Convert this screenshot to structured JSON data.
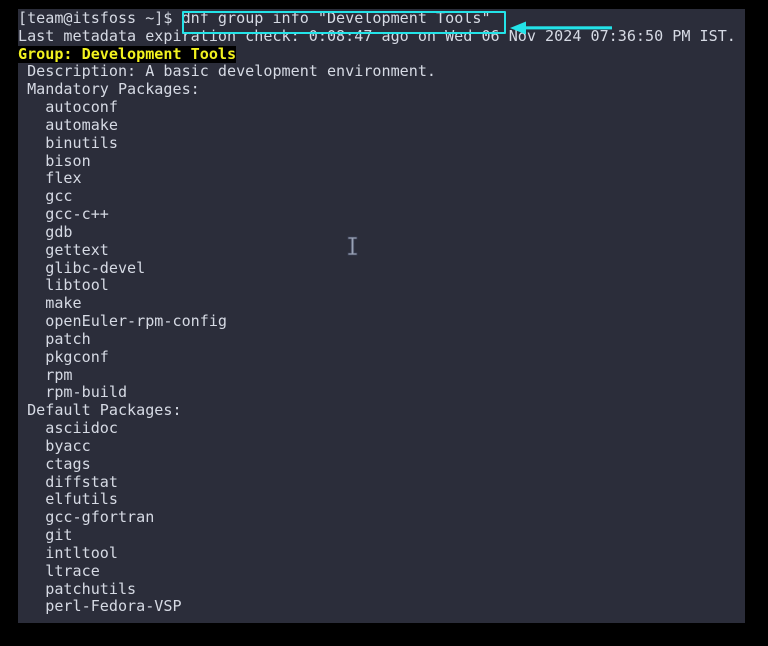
{
  "terminal": {
    "background_color": "#2b2d3a",
    "text_color": "#d6dae4",
    "prompt": "[team@itsfoss ~]$ ",
    "command": "dnf group info \"Development Tools\"",
    "metadata_line": "Last metadata expiration check: 0:08:47 ago on Wed 06 Nov 2024 07:36:50 PM IST.",
    "group_line": "Group: Development Tools",
    "group_line_color": "#f2f21f",
    "group_line_background": "#000000",
    "description_line": " Description: A basic development environment.",
    "mandatory_header": " Mandatory Packages:",
    "mandatory_packages": [
      "autoconf",
      "automake",
      "binutils",
      "bison",
      "flex",
      "gcc",
      "gcc-c++",
      "gdb",
      "gettext",
      "glibc-devel",
      "libtool",
      "make",
      "openEuler-rpm-config",
      "patch",
      "pkgconf",
      "rpm",
      "rpm-build"
    ],
    "default_header": " Default Packages:",
    "default_packages": [
      "asciidoc",
      "byacc",
      "ctags",
      "diffstat",
      "elfutils",
      "gcc-gfortran",
      "git",
      "intltool",
      "ltrace",
      "patchutils",
      "perl-Fedora-VSP"
    ]
  },
  "annotations": {
    "highlight_color": "#23e3e8",
    "command_box_label": "dnf group info \"Development Tools\"",
    "arrow_label": "pointer-to-command"
  }
}
